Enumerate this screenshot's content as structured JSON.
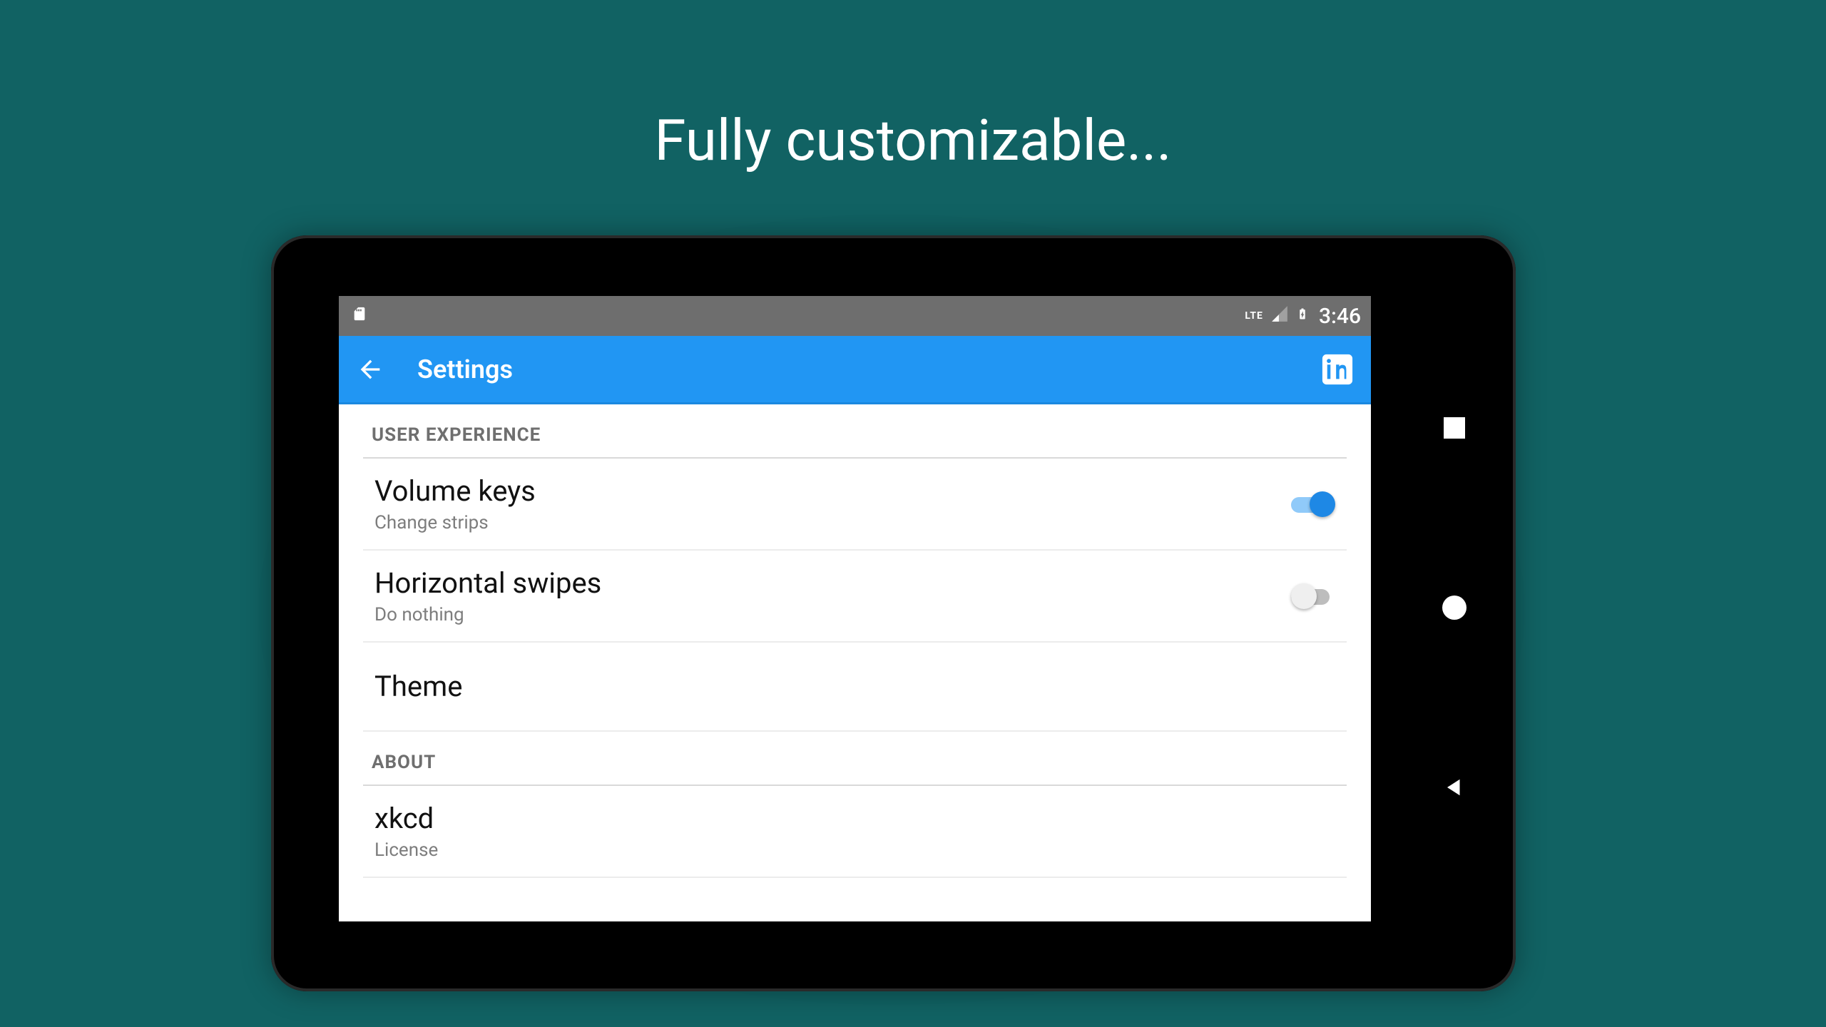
{
  "promo": {
    "headline": "Fully customizable..."
  },
  "statusbar": {
    "network": "LTE",
    "time": "3:46"
  },
  "appbar": {
    "title": "Settings"
  },
  "settings": {
    "sections": [
      {
        "header": "USER EXPERIENCE",
        "items": [
          {
            "title": "Volume keys",
            "subtitle": "Change strips",
            "toggle": true,
            "toggle_on": true
          },
          {
            "title": "Horizontal swipes",
            "subtitle": "Do nothing",
            "toggle": true,
            "toggle_on": false
          },
          {
            "title": "Theme",
            "subtitle": null,
            "toggle": false
          }
        ]
      },
      {
        "header": "ABOUT",
        "items": [
          {
            "title": "xkcd",
            "subtitle": "License",
            "toggle": false
          }
        ]
      }
    ]
  }
}
